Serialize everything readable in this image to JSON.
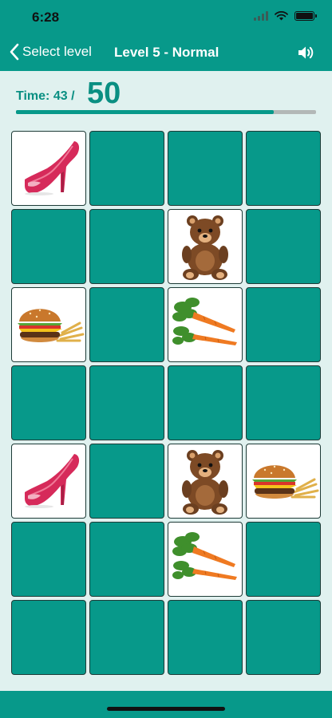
{
  "status": {
    "time": "6:28"
  },
  "nav": {
    "back_label": "Select level",
    "title": "Level 5 - Normal"
  },
  "timer": {
    "label": "Time: 43 /",
    "total": "50",
    "elapsed": 43,
    "limit": 50
  },
  "colors": {
    "teal": "#07998a",
    "card_open": "#ffffff",
    "background": "#e0f1ef"
  },
  "grid": {
    "columns": 4,
    "rows": 7,
    "cards": [
      [
        "shoe",
        "hidden",
        "hidden",
        "hidden"
      ],
      [
        "hidden",
        "hidden",
        "bear",
        "hidden"
      ],
      [
        "burger",
        "hidden",
        "carrot",
        "hidden"
      ],
      [
        "hidden",
        "hidden",
        "hidden",
        "hidden"
      ],
      [
        "shoe",
        "hidden",
        "bear",
        "burger"
      ],
      [
        "hidden",
        "hidden",
        "carrot",
        "hidden"
      ],
      [
        "hidden",
        "hidden",
        "hidden",
        "hidden"
      ]
    ]
  }
}
